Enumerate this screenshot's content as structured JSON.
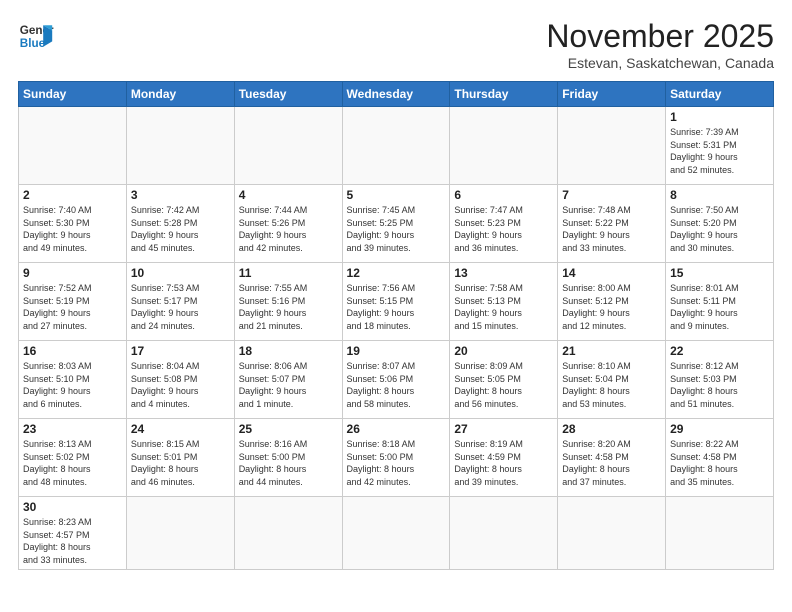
{
  "header": {
    "logo_text_normal": "General",
    "logo_text_blue": "Blue",
    "month_title": "November 2025",
    "location": "Estevan, Saskatchewan, Canada"
  },
  "weekdays": [
    "Sunday",
    "Monday",
    "Tuesday",
    "Wednesday",
    "Thursday",
    "Friday",
    "Saturday"
  ],
  "weeks": [
    [
      {
        "day": "",
        "info": ""
      },
      {
        "day": "",
        "info": ""
      },
      {
        "day": "",
        "info": ""
      },
      {
        "day": "",
        "info": ""
      },
      {
        "day": "",
        "info": ""
      },
      {
        "day": "",
        "info": ""
      },
      {
        "day": "1",
        "info": "Sunrise: 7:39 AM\nSunset: 5:31 PM\nDaylight: 9 hours\nand 52 minutes."
      }
    ],
    [
      {
        "day": "2",
        "info": "Sunrise: 7:40 AM\nSunset: 5:30 PM\nDaylight: 9 hours\nand 49 minutes."
      },
      {
        "day": "3",
        "info": "Sunrise: 7:42 AM\nSunset: 5:28 PM\nDaylight: 9 hours\nand 45 minutes."
      },
      {
        "day": "4",
        "info": "Sunrise: 7:44 AM\nSunset: 5:26 PM\nDaylight: 9 hours\nand 42 minutes."
      },
      {
        "day": "5",
        "info": "Sunrise: 7:45 AM\nSunset: 5:25 PM\nDaylight: 9 hours\nand 39 minutes."
      },
      {
        "day": "6",
        "info": "Sunrise: 7:47 AM\nSunset: 5:23 PM\nDaylight: 9 hours\nand 36 minutes."
      },
      {
        "day": "7",
        "info": "Sunrise: 7:48 AM\nSunset: 5:22 PM\nDaylight: 9 hours\nand 33 minutes."
      },
      {
        "day": "8",
        "info": "Sunrise: 7:50 AM\nSunset: 5:20 PM\nDaylight: 9 hours\nand 30 minutes."
      }
    ],
    [
      {
        "day": "9",
        "info": "Sunrise: 7:52 AM\nSunset: 5:19 PM\nDaylight: 9 hours\nand 27 minutes."
      },
      {
        "day": "10",
        "info": "Sunrise: 7:53 AM\nSunset: 5:17 PM\nDaylight: 9 hours\nand 24 minutes."
      },
      {
        "day": "11",
        "info": "Sunrise: 7:55 AM\nSunset: 5:16 PM\nDaylight: 9 hours\nand 21 minutes."
      },
      {
        "day": "12",
        "info": "Sunrise: 7:56 AM\nSunset: 5:15 PM\nDaylight: 9 hours\nand 18 minutes."
      },
      {
        "day": "13",
        "info": "Sunrise: 7:58 AM\nSunset: 5:13 PM\nDaylight: 9 hours\nand 15 minutes."
      },
      {
        "day": "14",
        "info": "Sunrise: 8:00 AM\nSunset: 5:12 PM\nDaylight: 9 hours\nand 12 minutes."
      },
      {
        "day": "15",
        "info": "Sunrise: 8:01 AM\nSunset: 5:11 PM\nDaylight: 9 hours\nand 9 minutes."
      }
    ],
    [
      {
        "day": "16",
        "info": "Sunrise: 8:03 AM\nSunset: 5:10 PM\nDaylight: 9 hours\nand 6 minutes."
      },
      {
        "day": "17",
        "info": "Sunrise: 8:04 AM\nSunset: 5:08 PM\nDaylight: 9 hours\nand 4 minutes."
      },
      {
        "day": "18",
        "info": "Sunrise: 8:06 AM\nSunset: 5:07 PM\nDaylight: 9 hours\nand 1 minute."
      },
      {
        "day": "19",
        "info": "Sunrise: 8:07 AM\nSunset: 5:06 PM\nDaylight: 8 hours\nand 58 minutes."
      },
      {
        "day": "20",
        "info": "Sunrise: 8:09 AM\nSunset: 5:05 PM\nDaylight: 8 hours\nand 56 minutes."
      },
      {
        "day": "21",
        "info": "Sunrise: 8:10 AM\nSunset: 5:04 PM\nDaylight: 8 hours\nand 53 minutes."
      },
      {
        "day": "22",
        "info": "Sunrise: 8:12 AM\nSunset: 5:03 PM\nDaylight: 8 hours\nand 51 minutes."
      }
    ],
    [
      {
        "day": "23",
        "info": "Sunrise: 8:13 AM\nSunset: 5:02 PM\nDaylight: 8 hours\nand 48 minutes."
      },
      {
        "day": "24",
        "info": "Sunrise: 8:15 AM\nSunset: 5:01 PM\nDaylight: 8 hours\nand 46 minutes."
      },
      {
        "day": "25",
        "info": "Sunrise: 8:16 AM\nSunset: 5:00 PM\nDaylight: 8 hours\nand 44 minutes."
      },
      {
        "day": "26",
        "info": "Sunrise: 8:18 AM\nSunset: 5:00 PM\nDaylight: 8 hours\nand 42 minutes."
      },
      {
        "day": "27",
        "info": "Sunrise: 8:19 AM\nSunset: 4:59 PM\nDaylight: 8 hours\nand 39 minutes."
      },
      {
        "day": "28",
        "info": "Sunrise: 8:20 AM\nSunset: 4:58 PM\nDaylight: 8 hours\nand 37 minutes."
      },
      {
        "day": "29",
        "info": "Sunrise: 8:22 AM\nSunset: 4:58 PM\nDaylight: 8 hours\nand 35 minutes."
      }
    ],
    [
      {
        "day": "30",
        "info": "Sunrise: 8:23 AM\nSunset: 4:57 PM\nDaylight: 8 hours\nand 33 minutes."
      },
      {
        "day": "",
        "info": ""
      },
      {
        "day": "",
        "info": ""
      },
      {
        "day": "",
        "info": ""
      },
      {
        "day": "",
        "info": ""
      },
      {
        "day": "",
        "info": ""
      },
      {
        "day": "",
        "info": ""
      }
    ]
  ]
}
